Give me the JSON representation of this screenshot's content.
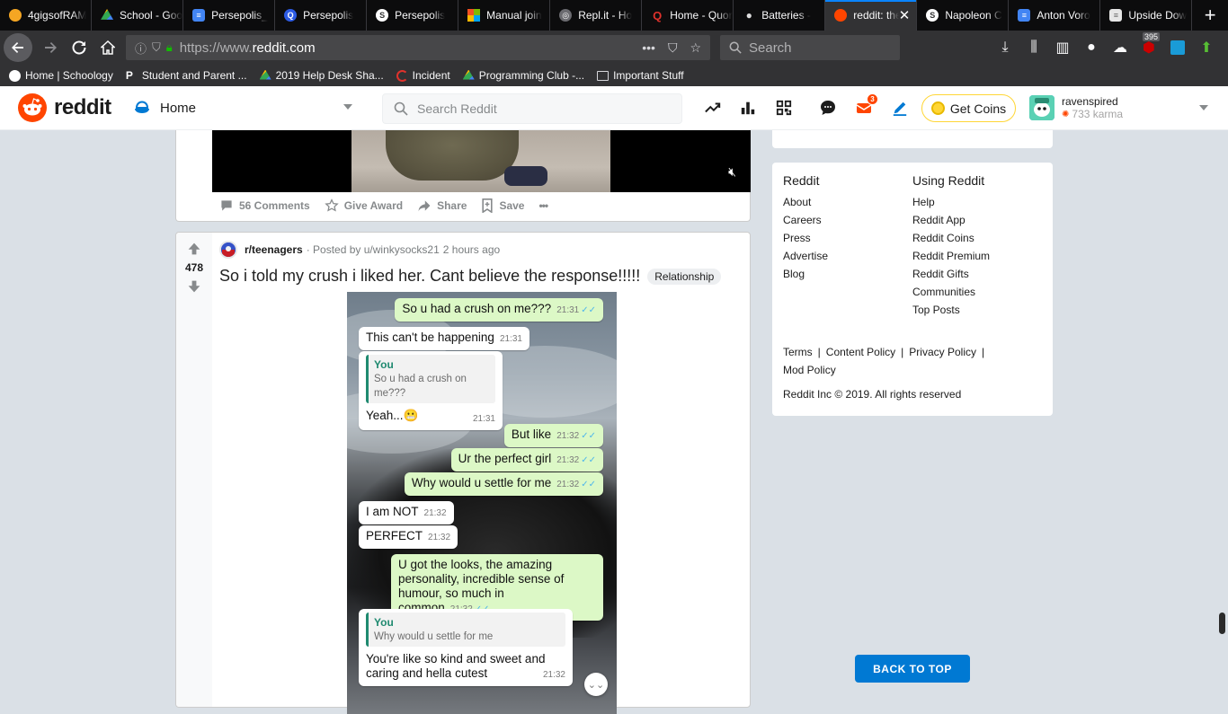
{
  "browser": {
    "tabs": [
      {
        "label": "4gigsofRAM",
        "color": "#f5a623",
        "glyph": "●"
      },
      {
        "label": "School - Google",
        "color": "#1fa463",
        "glyph": "▲"
      },
      {
        "label": "Persepolis_",
        "color": "#4285f4",
        "glyph": "≡"
      },
      {
        "label": "Persepolis",
        "color": "#2d5be3",
        "glyph": "Q"
      },
      {
        "label": "Persepolis",
        "color": "#5b5b5f",
        "glyph": "S"
      },
      {
        "label": "Manual join",
        "color": "#f25022",
        "glyph": "■"
      },
      {
        "label": "Repl.it - Ho",
        "color": "#5b5b5f",
        "glyph": "◎"
      },
      {
        "label": "Home - Quora",
        "color": "#b92b27",
        "glyph": "Q"
      },
      {
        "label": "Batteries -",
        "color": "#888888",
        "glyph": ""
      },
      {
        "label": "reddit: the",
        "color": "#ff4500",
        "glyph": "●"
      },
      {
        "label": "Napoleon C",
        "color": "#5b5b5f",
        "glyph": "S"
      },
      {
        "label": "Anton Voro",
        "color": "#4285f4",
        "glyph": "≡"
      },
      {
        "label": "Upside Dow",
        "color": "#e6e6e6",
        "glyph": ""
      }
    ],
    "url_prefix": "https://www.",
    "url_domain": "reddit.com",
    "search_placeholder": "Search",
    "badge_count": "395",
    "bookmarks": [
      {
        "label": "Home | Schoology",
        "icon": "schoology-icon"
      },
      {
        "label": "Student and Parent ...",
        "icon": "powerschool-icon"
      },
      {
        "label": "2019 Help Desk Sha...",
        "icon": "drive-icon"
      },
      {
        "label": "Incident",
        "icon": "servicenow-icon"
      },
      {
        "label": "Programming Club -...",
        "icon": "drive-icon"
      },
      {
        "label": "Important Stuff",
        "icon": "folder-icon"
      }
    ]
  },
  "reddit": {
    "wordmark": "reddit",
    "home_label": "Home",
    "search_placeholder": "Search Reddit",
    "mail_badge": "3",
    "get_coins": "Get Coins",
    "username": "ravenspired",
    "karma": "733 karma",
    "accent": "#0079d3",
    "brand": "#ff4500"
  },
  "post1": {
    "comments": "56 Comments",
    "give_award": "Give Award",
    "share": "Share",
    "save": "Save",
    "more": "•••"
  },
  "post2": {
    "score": "478",
    "subreddit": "r/teenagers",
    "posted_by": "· Posted by u/winkysocks21",
    "time": "2 hours ago",
    "title": "So i told my crush i liked her. Cant believe the response!!!!!",
    "flair": "Relationship",
    "chat": [
      {
        "text": "So u had a crush on me???",
        "time": "21:31"
      },
      {
        "text": "This can't be happening",
        "time": "21:31"
      },
      {
        "quote_name": "You",
        "quote_text": "So u had a crush on me???",
        "text": "Yeah...😬",
        "time": "21:31"
      },
      {
        "text": "But like",
        "time": "21:32"
      },
      {
        "text": "Ur the perfect girl",
        "time": "21:32"
      },
      {
        "text": "Why would u settle for me",
        "time": "21:32"
      },
      {
        "text": "I am NOT",
        "time": "21:32"
      },
      {
        "text": "PERFECT",
        "time": "21:32"
      },
      {
        "text": "U got the looks, the amazing personality, incredible sense of humour, so much in common",
        "time": "21:32"
      },
      {
        "quote_name": "You",
        "quote_text": "Why would u settle for me",
        "text": "You're like so kind and sweet and caring and hella cutest",
        "time": "21:32"
      }
    ]
  },
  "footer": {
    "col1_title": "Reddit",
    "col1": [
      "About",
      "Careers",
      "Press",
      "Advertise",
      "Blog"
    ],
    "col2_title": "Using Reddit",
    "col2": [
      "Help",
      "Reddit App",
      "Reddit Coins",
      "Reddit Premium",
      "Reddit Gifts",
      "Communities",
      "Top Posts"
    ],
    "terms": "Terms",
    "content_policy": "Content Policy",
    "privacy_policy": "Privacy Policy",
    "mod_policy": "Mod Policy",
    "copyright": "Reddit Inc © 2019. All rights reserved"
  },
  "back_to_top": "BACK TO TOP"
}
